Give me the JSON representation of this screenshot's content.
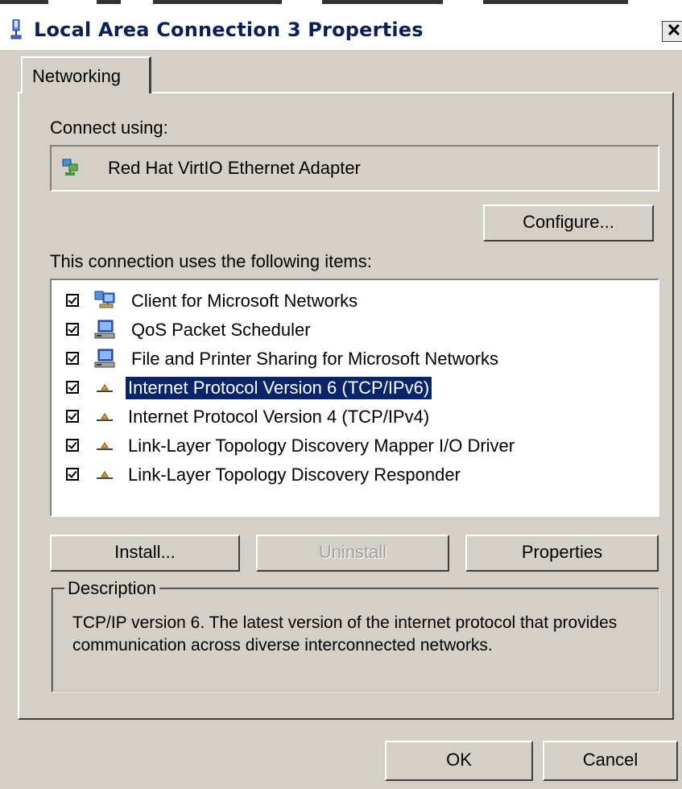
{
  "window": {
    "title": "Local Area Connection 3 Properties",
    "close_label": "✕"
  },
  "tabs": [
    {
      "label": "Networking"
    }
  ],
  "connect_using": {
    "label": "Connect using:",
    "adapter": "Red Hat VirtIO Ethernet Adapter",
    "configure_label": "Configure..."
  },
  "items_section": {
    "label": "This connection uses the following items:",
    "items": [
      {
        "label": "Client for Microsoft Networks",
        "checked": true,
        "icon": "network-client-icon"
      },
      {
        "label": "QoS Packet Scheduler",
        "checked": true,
        "icon": "computer-service-icon"
      },
      {
        "label": "File and Printer Sharing for Microsoft Networks",
        "checked": true,
        "icon": "computer-service-icon"
      },
      {
        "label": "Internet Protocol Version 6 (TCP/IPv6)",
        "checked": true,
        "icon": "protocol-icon",
        "selected": true
      },
      {
        "label": "Internet Protocol Version 4 (TCP/IPv4)",
        "checked": true,
        "icon": "protocol-icon"
      },
      {
        "label": "Link-Layer Topology Discovery Mapper I/O Driver",
        "checked": true,
        "icon": "protocol-icon"
      },
      {
        "label": "Link-Layer Topology Discovery Responder",
        "checked": true,
        "icon": "protocol-icon"
      }
    ]
  },
  "actions": {
    "install_label": "Install...",
    "uninstall_label": "Uninstall",
    "properties_label": "Properties"
  },
  "description": {
    "legend": "Description",
    "text": "TCP/IP version 6. The latest version of the internet protocol that provides communication across diverse interconnected networks."
  },
  "footer": {
    "ok_label": "OK",
    "cancel_label": "Cancel"
  },
  "colors": {
    "face": "#d4d0c8",
    "selection": "#0a246a",
    "title_text": "#0b1f55"
  }
}
